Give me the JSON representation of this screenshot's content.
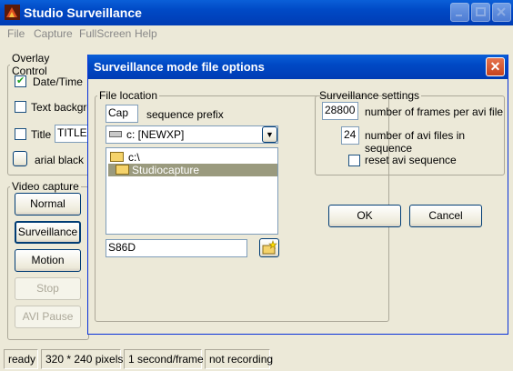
{
  "main_window": {
    "title": "Studio Surveillance",
    "menu": [
      "File",
      "Capture",
      "FullScreen",
      "Help"
    ]
  },
  "overlay_control": {
    "legend": "Overlay  Control",
    "datetime_label": "Date/Time",
    "datetime_checked": true,
    "textbg_label": "Text backgro",
    "title_label": "Title",
    "title_value": "TITLE",
    "font_label": "arial black 1"
  },
  "video_capture": {
    "legend": "Video capture",
    "buttons": [
      "Normal",
      "Surveillance",
      "Motion",
      "Stop",
      "AVI Pause"
    ]
  },
  "statusbar": {
    "cells": [
      "ready",
      "320 *  240 pixels",
      "1 second/frame",
      "not recording"
    ]
  },
  "dialog": {
    "title": "Surveillance mode file options",
    "file_location": {
      "legend": "File location",
      "prefix_value": "Cap",
      "prefix_label": "sequence  prefix",
      "drive_value": "c: [NEWXP]",
      "tree": [
        "c:\\",
        "Studiocapture"
      ],
      "filename_value": "S86D"
    },
    "settings": {
      "legend": "Surveillance settings",
      "frames_value": "28800",
      "frames_label": "number of frames per avi file",
      "files_value": "24",
      "files_label": "number of avi files in sequence",
      "reset_label": "reset avi sequence",
      "reset_checked": false
    },
    "ok_label": "OK",
    "cancel_label": "Cancel"
  }
}
